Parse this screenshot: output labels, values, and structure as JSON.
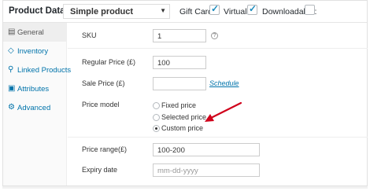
{
  "header": {
    "title": "Product Data —",
    "product_type": "Simple product",
    "gift_card_label": "Gift Card:",
    "virtual_label": "Virtual:",
    "downloadable_label": "Downloadable:",
    "gift_card_checked": true,
    "virtual_checked": true,
    "downloadable_checked": false
  },
  "sidebar": {
    "items": [
      {
        "label": "General",
        "icon": "wrench-icon",
        "active": true
      },
      {
        "label": "Inventory",
        "icon": "inventory-icon",
        "active": false
      },
      {
        "label": "Linked Products",
        "icon": "link-icon",
        "active": false
      },
      {
        "label": "Attributes",
        "icon": "list-icon",
        "active": false
      },
      {
        "label": "Advanced",
        "icon": "gear-icon",
        "active": false
      }
    ]
  },
  "form": {
    "sku_label": "SKU",
    "sku_value": "1",
    "regular_price_label": "Regular Price (£)",
    "regular_price_value": "100",
    "sale_price_label": "Sale Price (£)",
    "sale_price_value": "",
    "schedule_link": "Schedule",
    "price_model_label": "Price model",
    "price_model_options": [
      "Fixed price",
      "Selected price",
      "Custom price"
    ],
    "price_model_selected": "Custom price",
    "price_range_label": "Price range(£)",
    "price_range_value": "100-200",
    "expiry_date_label": "Expiry date",
    "expiry_date_placeholder": "mm-dd-yyyy"
  },
  "colors": {
    "link": "#0073aa",
    "annotation_arrow": "#d0021b"
  }
}
